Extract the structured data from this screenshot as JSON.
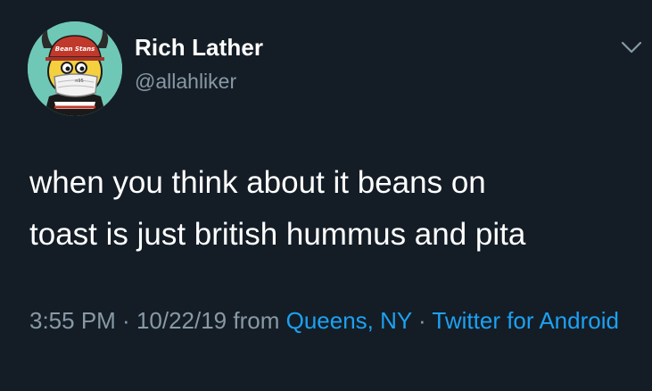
{
  "user": {
    "display_name": "Rich Lather",
    "handle": "@allahliker"
  },
  "avatar": {
    "cap_text": "Bean Stans",
    "mask_text": "n95"
  },
  "tweet": {
    "text_line1": "when you think about it beans on",
    "text_line2": "toast is just british hummus and pita"
  },
  "meta": {
    "time": "3:55 PM",
    "separator1": " · ",
    "date": "10/22/19",
    "from_label": " from ",
    "location": "Queens, NY",
    "separator2": " · ",
    "client": "Twitter for Android"
  },
  "icons": {
    "menu": "chevron-down-icon"
  },
  "colors": {
    "background": "#141d26",
    "primary_text": "#ffffff",
    "secondary_text": "#8899a6",
    "link": "#1da1f2",
    "avatar_bg": "#6fc8b6"
  }
}
